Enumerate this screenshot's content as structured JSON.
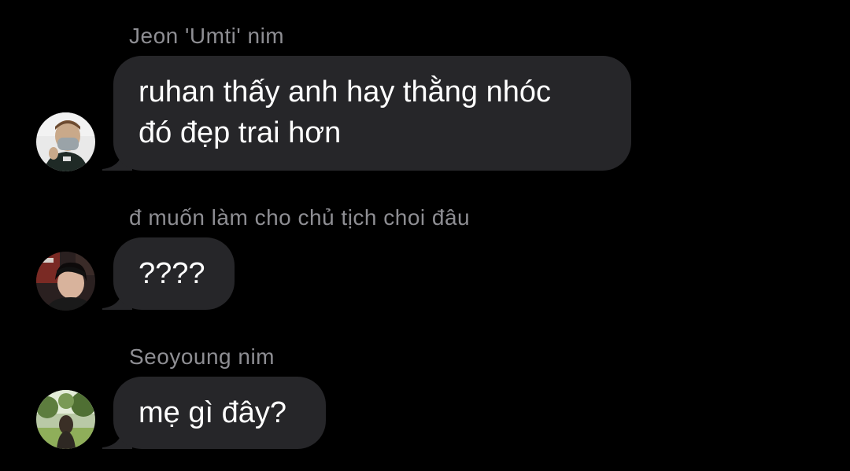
{
  "app": {
    "background": "#000000",
    "bubble_color": "#262629",
    "name_color": "#8e8e93",
    "text_color": "#ffffff"
  },
  "messages": [
    {
      "sender": "Jeon 'Umti' nim",
      "lines": [
        "ruhan thấy anh hay thằng nhóc",
        "đó đẹp trai hơn"
      ],
      "avatar_icon": "avatar-masked-man"
    },
    {
      "sender": "đ muốn làm cho chủ tịch choi đâu",
      "lines": [
        "????"
      ],
      "avatar_icon": "avatar-dark-hair"
    },
    {
      "sender": "Seoyoung nim",
      "lines": [
        "mẹ gì đây?"
      ],
      "avatar_icon": "avatar-outdoor-trees"
    }
  ]
}
